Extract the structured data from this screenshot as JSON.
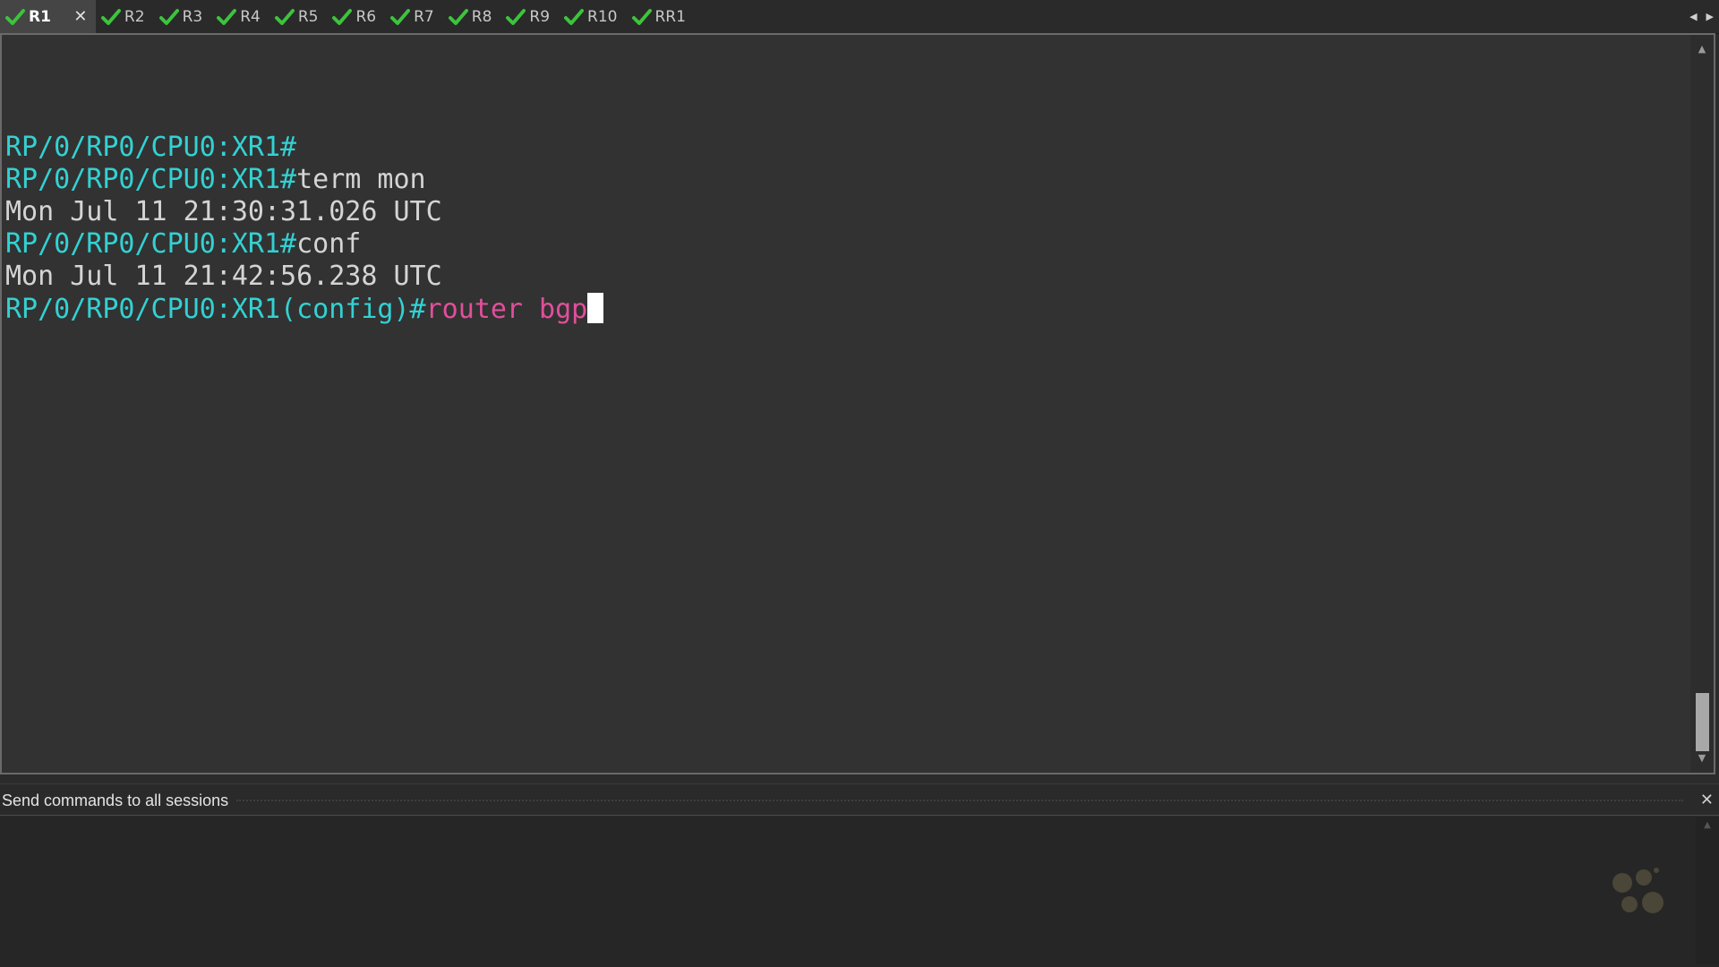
{
  "tabs": [
    {
      "label": "R1",
      "active": true
    },
    {
      "label": "R2"
    },
    {
      "label": "R3"
    },
    {
      "label": "R4"
    },
    {
      "label": "R5"
    },
    {
      "label": "R6"
    },
    {
      "label": "R7"
    },
    {
      "label": "R8"
    },
    {
      "label": "R9"
    },
    {
      "label": "R10"
    },
    {
      "label": "RR1"
    }
  ],
  "icons": {
    "tab_status": "check-icon",
    "tab_close": "close-icon",
    "scroll_left": "caret-left-icon",
    "scroll_right": "caret-right-icon",
    "close_glyph": "✕"
  },
  "colors": {
    "check": "#3cc43c",
    "prompt": "#33d1d3",
    "command": "#d4d4d4",
    "pending_command": "#e14f9b"
  },
  "terminal": {
    "lines": [
      {
        "prompt": "RP/0/RP0/CPU0:XR1#",
        "command": ""
      },
      {
        "prompt": "RP/0/RP0/CPU0:XR1#",
        "command": "term mon"
      },
      {
        "prompt": "",
        "command": "Mon Jul 11 21:30:31.026 UTC"
      },
      {
        "prompt": "RP/0/RP0/CPU0:XR1#",
        "command": "conf"
      },
      {
        "prompt": "",
        "command": "Mon Jul 11 21:42:56.238 UTC"
      },
      {
        "prompt": "RP/0/RP0/CPU0:XR1(config)#",
        "command": "router bgp",
        "pending": true
      }
    ]
  },
  "send_panel": {
    "title": "Send commands to all sessions",
    "input_value": ""
  }
}
